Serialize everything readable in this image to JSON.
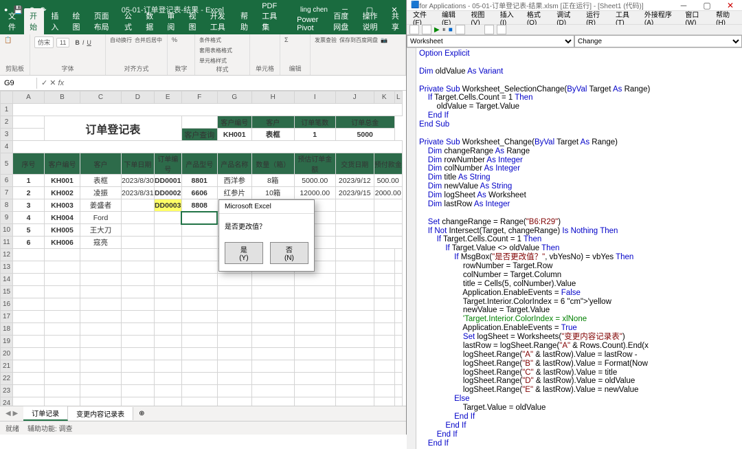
{
  "excel": {
    "title": "05-01-订单登记表-结果 - Excel",
    "user": "ling chen",
    "qat": [
      "save",
      "undo",
      "redo"
    ],
    "ribbon_tabs": [
      "文件",
      "开始",
      "插入",
      "绘图",
      "页面布局",
      "公式",
      "数据",
      "审阅",
      "视图",
      "开发工具",
      "帮助",
      "PDF工具集",
      "Power Pivot",
      "百度网盘"
    ],
    "active_tab": "开始",
    "tell_me": "操作说明",
    "share": "共享",
    "ribbon_groups": {
      "clipboard": {
        "label": "剪贴板",
        "paste": "粘贴"
      },
      "font": {
        "label": "字体",
        "name": "仿宋",
        "size": "11"
      },
      "align": {
        "label": "对齐方式",
        "wrap": "自动换行",
        "merge": "合并后居中"
      },
      "number": {
        "label": "数字"
      },
      "styles": {
        "label": "样式",
        "cf": "条件格式",
        "ft": "套用表格格式",
        "cs": "单元格样式"
      },
      "cells": {
        "label": "单元格"
      },
      "editing": {
        "label": "编辑"
      },
      "addins": {
        "label": "发票查验",
        "save": "保存到百度网盘",
        "cam": "相机"
      }
    },
    "name_box": "G9",
    "formula": "",
    "columns": [
      "A",
      "B",
      "C",
      "D",
      "E",
      "F",
      "G",
      "H",
      "I",
      "J",
      "K",
      "L"
    ],
    "title_text": "订单登记表",
    "query": {
      "label": "客户查询",
      "h1": "客户编号",
      "h2": "客户",
      "h3": "订单笔数",
      "h4": "订单总金",
      "v1": "KH001",
      "v2": "表框",
      "v3": "1",
      "v4": "5000"
    },
    "headers": [
      "序号",
      "客户编号",
      "客户",
      "下单日期",
      "订单编号",
      "产品型号",
      "产品名称",
      "数量（箱）",
      "预估订单金额",
      "交货日期",
      "预付款金"
    ],
    "rows": [
      {
        "n": "1",
        "id": "KH001",
        "cust": "表框",
        "date": "2023/8/30",
        "ord": "DD0001",
        "mdl": "8801",
        "prod": "西洋参",
        "qty": "8箱",
        "amt": "5000.00",
        "ship": "2023/9/12",
        "pay": "500.00"
      },
      {
        "n": "2",
        "id": "KH002",
        "cust": "凌振",
        "date": "2023/8/31",
        "ord": "DD0002",
        "mdl": "6606",
        "prod": "红参片",
        "qty": "10箱",
        "amt": "12000.00",
        "ship": "2023/9/15",
        "pay": "2000.00"
      },
      {
        "n": "3",
        "id": "KH003",
        "cust": "姜盛者",
        "date": "",
        "ord": "DD0003",
        "mdl": "8808",
        "prod": "",
        "qty": "",
        "amt": "",
        "ship": "",
        "pay": "",
        "hl_ord": true
      },
      {
        "n": "4",
        "id": "KH004",
        "cust": "Ford",
        "date": "",
        "ord": "",
        "mdl": "",
        "prod": "",
        "qty": "",
        "amt": "",
        "ship": "",
        "pay": "",
        "sel": true
      },
      {
        "n": "5",
        "id": "KH005",
        "cust": "王大刀",
        "date": "",
        "ord": "",
        "mdl": "",
        "prod": "",
        "qty": "",
        "amt": "",
        "ship": "",
        "pay": ""
      },
      {
        "n": "6",
        "id": "KH006",
        "cust": "寇亮",
        "date": "",
        "ord": "",
        "mdl": "",
        "prod": "",
        "qty": "",
        "amt": "",
        "ship": "",
        "pay": ""
      }
    ],
    "blank_rows_start": 12,
    "blank_rows_end": 24,
    "dialog": {
      "title": "Microsoft Excel",
      "body": "是否更改值？",
      "yes": "是(Y)",
      "no": "否(N)"
    },
    "sheets": [
      "订单记录",
      "变更内容记录表"
    ],
    "active_sheet": "订单记录",
    "status_ready": "就绪",
    "status_acc": "辅助功能: 调查"
  },
  "vba": {
    "title": "for Applications - 05-01-订单登记表-结果.xlsm [正在运行] - [Sheet1 (代码)]",
    "menus": [
      "文件(F)",
      "编辑(E)",
      "视图(V)",
      "插入(I)",
      "格式(O)",
      "调试(D)",
      "运行(R)",
      "工具(T)",
      "外接程序(A)",
      "窗口(W)",
      "帮助(H)"
    ],
    "dd_obj": "Worksheet",
    "dd_proc": "Change",
    "code_lines": [
      {
        "t": "Option Explicit",
        "kw": [
          "Option",
          "Explicit"
        ]
      },
      {
        "t": ""
      },
      {
        "t": "Dim oldValue As Variant",
        "kw": [
          "Dim",
          "As",
          "Variant"
        ]
      },
      {
        "t": ""
      },
      {
        "t": "Private Sub Worksheet_SelectionChange(ByVal Target As Range)",
        "kw": [
          "Private",
          "Sub",
          "ByVal",
          "As"
        ]
      },
      {
        "t": "    If Target.Cells.Count = 1 Then",
        "kw": [
          "If",
          "Then"
        ]
      },
      {
        "t": "        oldValue = Target.Value"
      },
      {
        "t": "    End If",
        "kw": [
          "End",
          "If"
        ]
      },
      {
        "t": "End Sub",
        "kw": [
          "End",
          "Sub"
        ]
      },
      {
        "t": ""
      },
      {
        "t": "Private Sub Worksheet_Change(ByVal Target As Range)",
        "kw": [
          "Private",
          "Sub",
          "ByVal",
          "As"
        ]
      },
      {
        "t": "    Dim changeRange As Range",
        "kw": [
          "Dim",
          "As"
        ]
      },
      {
        "t": "    Dim rowNumber As Integer",
        "kw": [
          "Dim",
          "As",
          "Integer"
        ]
      },
      {
        "t": "    Dim colNumber As Integer",
        "kw": [
          "Dim",
          "As",
          "Integer"
        ]
      },
      {
        "t": "    Dim title As String",
        "kw": [
          "Dim",
          "As",
          "String"
        ]
      },
      {
        "t": "    Dim newValue As String",
        "kw": [
          "Dim",
          "As",
          "String"
        ]
      },
      {
        "t": "    Dim logSheet As Worksheet",
        "kw": [
          "Dim",
          "As"
        ]
      },
      {
        "t": "    Dim lastRow As Integer",
        "kw": [
          "Dim",
          "As",
          "Integer"
        ]
      },
      {
        "t": ""
      },
      {
        "t": "    Set changeRange = Range(\"B6:R29\")",
        "kw": [
          "Set"
        ]
      },
      {
        "t": "    If Not Intersect(Target, changeRange) Is Nothing Then",
        "kw": [
          "If",
          "Not",
          "Is",
          "Nothing",
          "Then"
        ]
      },
      {
        "t": "        If Target.Cells.Count = 1 Then",
        "kw": [
          "If",
          "Then"
        ]
      },
      {
        "t": "            If Target.Value <> oldValue Then",
        "kw": [
          "If",
          "Then"
        ]
      },
      {
        "t": "                If MsgBox(\"是否更改值？\", vbYesNo) = vbYes Then",
        "kw": [
          "If",
          "Then"
        ]
      },
      {
        "t": "                    rowNumber = Target.Row"
      },
      {
        "t": "                    colNumber = Target.Column"
      },
      {
        "t": "                    title = Cells(5, colNumber).Value"
      },
      {
        "t": "                    Application.EnableEvents = False",
        "kw": [
          "False"
        ]
      },
      {
        "t": "                    Target.Interior.ColorIndex = 6 'yellow",
        "cm": "'yellow"
      },
      {
        "t": "                    newValue = Target.Value"
      },
      {
        "t": "                    'Target.Interior.ColorIndex = xlNone",
        "allcm": true
      },
      {
        "t": "                    Application.EnableEvents = True",
        "kw": [
          "True"
        ]
      },
      {
        "t": "                    Set logSheet = Worksheets(\"变更内容记录表\")",
        "kw": [
          "Set"
        ]
      },
      {
        "t": "                    lastRow = logSheet.Range(\"A\" & Rows.Count).End(x"
      },
      {
        "t": "                    logSheet.Range(\"A\" & lastRow).Value = lastRow -"
      },
      {
        "t": "                    logSheet.Range(\"B\" & lastRow).Value = Format(Now"
      },
      {
        "t": "                    logSheet.Range(\"C\" & lastRow).Value = title"
      },
      {
        "t": "                    logSheet.Range(\"D\" & lastRow).Value = oldValue"
      },
      {
        "t": "                    logSheet.Range(\"E\" & lastRow).Value = newValue"
      },
      {
        "t": "                Else",
        "kw": [
          "Else"
        ]
      },
      {
        "t": "                    Target.Value = oldValue"
      },
      {
        "t": "                End If",
        "kw": [
          "End",
          "If"
        ]
      },
      {
        "t": "            End If",
        "kw": [
          "End",
          "If"
        ]
      },
      {
        "t": "        End If",
        "kw": [
          "End",
          "If"
        ]
      },
      {
        "t": "    End If",
        "kw": [
          "End",
          "If"
        ]
      }
    ]
  }
}
